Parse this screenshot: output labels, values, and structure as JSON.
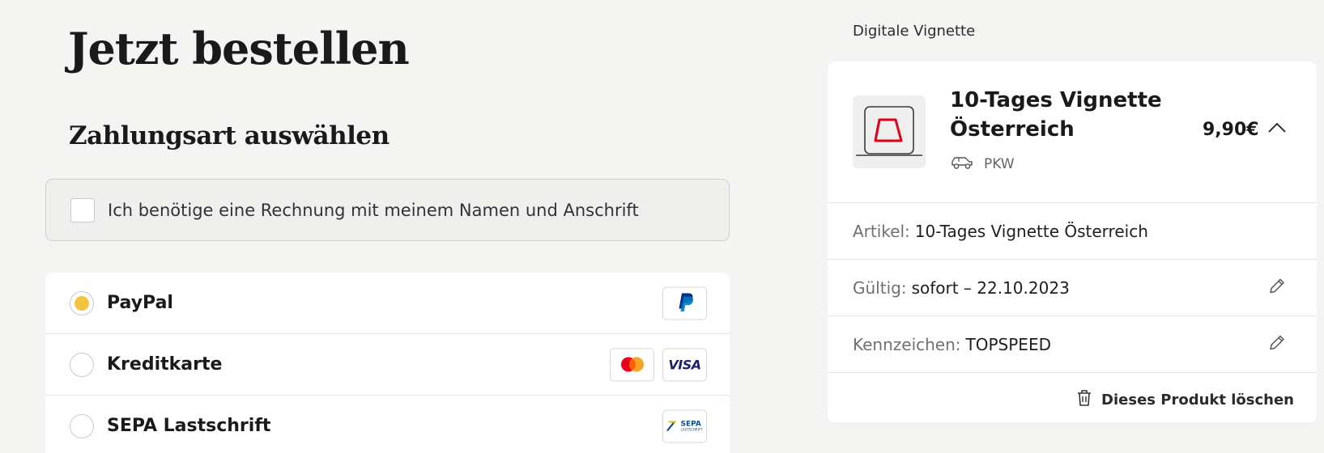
{
  "page": {
    "title": "Jetzt bestellen"
  },
  "payment": {
    "section_title": "Zahlungsart auswählen",
    "invoice_label": "Ich benötige eine Rechnung mit meinem Namen und Anschrift",
    "methods": [
      {
        "label": "PayPal",
        "selected": true,
        "logos": [
          "paypal-logo"
        ]
      },
      {
        "label": "Kreditkarte",
        "selected": false,
        "logos": [
          "mastercard-logo",
          "visa-logo"
        ]
      },
      {
        "label": "SEPA Lastschrift",
        "selected": false,
        "logos": [
          "sepa-logo"
        ]
      }
    ],
    "logo_text": {
      "visa": "VISA",
      "sepa": "SEPA",
      "sepa_sub": "LASTSCHRIFT"
    }
  },
  "cart": {
    "heading": "Digitale Vignette",
    "product": {
      "name": "10-Tages Vignette Österreich",
      "vehicle_type": "PKW",
      "price": "9,90€",
      "vehicle_icon": "car-icon"
    },
    "details": [
      {
        "key": "Artikel:",
        "value": "10-Tages Vignette Österreich",
        "editable": false
      },
      {
        "key": "Gültig:",
        "value": "sofort – 22.10.2023",
        "editable": true
      },
      {
        "key": "Kennzeichen:",
        "value": "TOPSPEED",
        "editable": true
      }
    ],
    "delete_label": "Dieses Produkt löschen"
  },
  "colors": {
    "background": "#f4f4f3",
    "accent_yellow": "#f5c242",
    "vignette_red": "#e0001b",
    "paypal_blue": "#003087",
    "visa_blue": "#1a1f71"
  }
}
